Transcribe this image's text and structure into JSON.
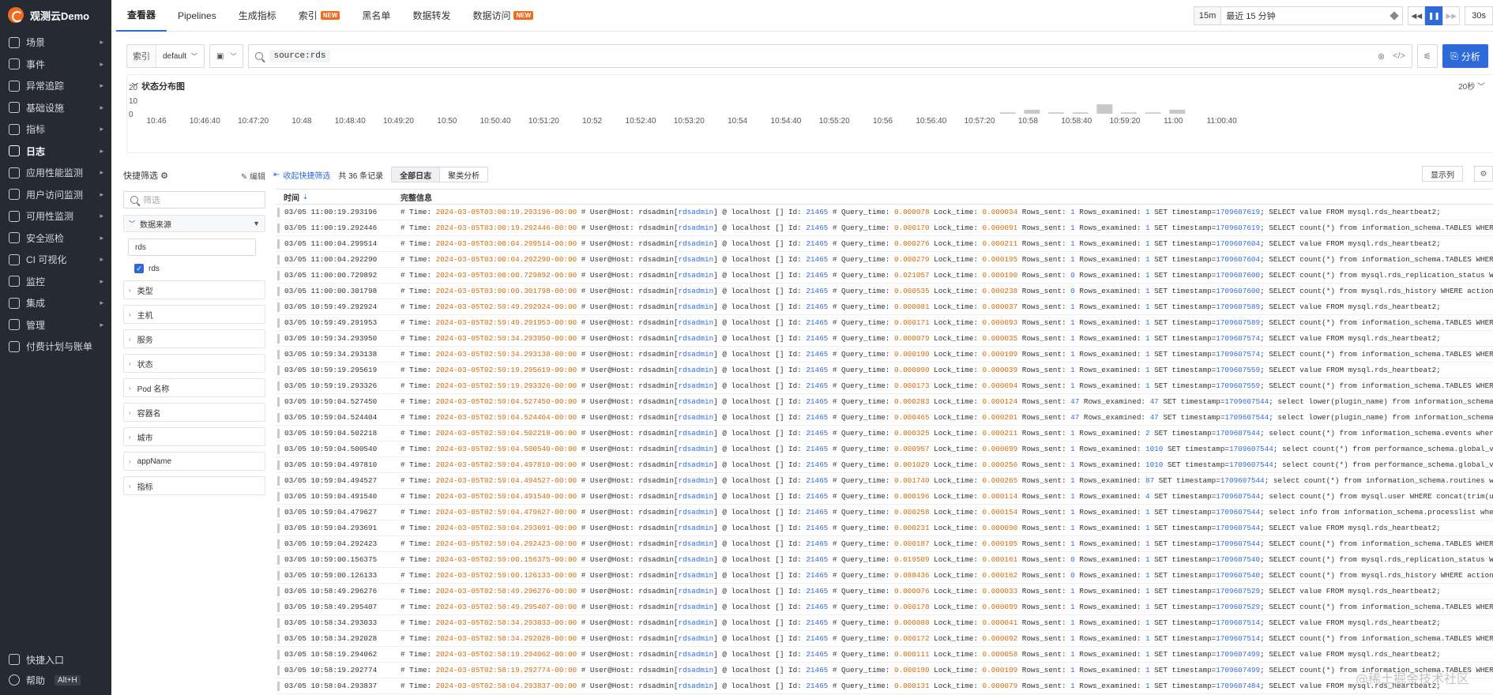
{
  "brand": {
    "name": "观测云Demo"
  },
  "sidebar": {
    "items": [
      {
        "label": "场景",
        "icon": "scene-icon"
      },
      {
        "label": "事件",
        "icon": "event-icon"
      },
      {
        "label": "异常追踪",
        "icon": "bug-icon"
      },
      {
        "label": "基础设施",
        "icon": "infrastructure-icon"
      },
      {
        "label": "指标",
        "icon": "metrics-icon"
      },
      {
        "label": "日志",
        "icon": "log-icon",
        "active": true
      },
      {
        "label": "应用性能监测",
        "icon": "apm-icon"
      },
      {
        "label": "用户访问监测",
        "icon": "rum-icon"
      },
      {
        "label": "可用性监测",
        "icon": "availability-icon"
      },
      {
        "label": "安全巡检",
        "icon": "shield-icon"
      },
      {
        "label": "CI 可视化",
        "icon": "ci-icon"
      },
      {
        "label": "监控",
        "icon": "monitor-icon"
      },
      {
        "label": "集成",
        "icon": "integration-icon"
      },
      {
        "label": "管理",
        "icon": "gear-icon"
      },
      {
        "label": "付费计划与账单",
        "icon": "billing-icon"
      }
    ],
    "bottom": {
      "quick_entry": "快捷入口",
      "help": "帮助",
      "help_key": "Alt+H"
    }
  },
  "topbar": {
    "tabs": [
      {
        "label": "查看器",
        "active": true,
        "new": false
      },
      {
        "label": "Pipelines",
        "new": false
      },
      {
        "label": "生成指标",
        "new": false
      },
      {
        "label": "索引",
        "new": true
      },
      {
        "label": "黑名单",
        "new": false
      },
      {
        "label": "数据转发",
        "new": false
      },
      {
        "label": "数据访问",
        "new": true
      }
    ],
    "new_badge": "NEW",
    "time_short": "15m",
    "time_range": "最近 15 分钟",
    "refresh_interval": "30s"
  },
  "query": {
    "index_label": "索引",
    "index_value": "default",
    "query_text": "source:rds",
    "analyze_label": "分析"
  },
  "chart_data": {
    "type": "bar",
    "title": "状态分布图",
    "interval": "20秒",
    "y_ticks": [
      20,
      10,
      0
    ],
    "ylim": [
      0,
      20
    ],
    "x_tick_labels": [
      "10:46",
      "10:46:40",
      "10:47:20",
      "10:48",
      "10:48:40",
      "10:49:20",
      "10:50",
      "10:50:40",
      "10:51:20",
      "10:52",
      "10:52:40",
      "10:53:20",
      "10:54",
      "10:54:40",
      "10:55:20",
      "10:56",
      "10:56:40",
      "10:57:20",
      "10:58",
      "10:58:40",
      "10:59:20",
      "11:00",
      "11:00:40"
    ],
    "categories": [
      "10:57:40",
      "10:58:00",
      "10:58:20",
      "10:58:40",
      "10:59:00",
      "10:59:20",
      "10:59:40",
      "11:00:00"
    ],
    "values": [
      1,
      3,
      1,
      1,
      7,
      1,
      1,
      3
    ]
  },
  "filters": {
    "title": "快捷筛选",
    "edit": "编辑",
    "search_placeholder": "筛选",
    "open_facet": {
      "label": "数据来源",
      "input_value": "rds",
      "checked_value": "rds"
    },
    "facets": [
      "类型",
      "主机",
      "服务",
      "状态",
      "Pod 名称",
      "容器名",
      "城市",
      "appName",
      "指标"
    ]
  },
  "table_toolbar": {
    "collapse_label": "收起快捷筛选",
    "count_label": "共 36 条记录",
    "view_all": "全部日志",
    "view_cluster": "聚类分析",
    "columns_label": "显示列"
  },
  "table": {
    "col_time": "时间",
    "col_msg": "完整信息",
    "rows": [
      {
        "t": "03/05 11:00:19.293196",
        "iso": "2024-03-05T03:00:19.293196-00:00",
        "qt": "0.000078",
        "lt": "0.000034",
        "rs": "1",
        "re": "1",
        "ts": "1709607619",
        "sql": "SELECT value FROM mysql.rds_heartbeat2;"
      },
      {
        "t": "03/05 11:00:19.292446",
        "iso": "2024-03-05T03:00:19.292446-00:00",
        "qt": "0.000170",
        "lt": "0.000091",
        "rs": "1",
        "re": "1",
        "ts": "1709607619",
        "sql": "SELECT count(*) from information_schema.TABLES WHERE TABLE_..."
      },
      {
        "t": "03/05 11:00:04.299514",
        "iso": "2024-03-05T03:00:04.299514-00:00",
        "qt": "0.000276",
        "lt": "0.000211",
        "rs": "1",
        "re": "1",
        "ts": "1709607604",
        "sql": "SELECT value FROM mysql.rds_heartbeat2;"
      },
      {
        "t": "03/05 11:00:04.292290",
        "iso": "2024-03-05T03:00:04.292290-00:00",
        "qt": "0.000279",
        "lt": "0.000195",
        "rs": "1",
        "re": "1",
        "ts": "1709607604",
        "sql": "SELECT count(*) from information_schema.TABLES WHERE TABLE_..."
      },
      {
        "t": "03/05 11:00:00.729892",
        "iso": "2024-03-05T03:00:00.729892-00:00",
        "qt": "0.021057",
        "lt": "0.000190",
        "rs": "0",
        "re": "1",
        "ts": "1709607600",
        "sql": "SELECT count(*) from mysql.rds_replication_status WHERE mas..."
      },
      {
        "t": "03/05 11:00:00.301798",
        "iso": "2024-03-05T03:00:00.301798-00:00",
        "qt": "0.000535",
        "lt": "0.000238",
        "rs": "0",
        "re": "1",
        "ts": "1709607600",
        "sql": "SELECT count(*) from mysql.rds_history WHERE action = 'disa..."
      },
      {
        "t": "03/05 10:59:49.292924",
        "iso": "2024-03-05T02:59:49.292924-00:00",
        "qt": "0.000081",
        "lt": "0.000037",
        "rs": "1",
        "re": "1",
        "ts": "1709607589",
        "sql": "SELECT value FROM mysql.rds_heartbeat2;"
      },
      {
        "t": "03/05 10:59:49.291953",
        "iso": "2024-03-05T02:59:49.291953-00:00",
        "qt": "0.000171",
        "lt": "0.000093",
        "rs": "1",
        "re": "1",
        "ts": "1709607589",
        "sql": "SELECT count(*) from information_schema.TABLES WHERE TABLE_..."
      },
      {
        "t": "03/05 10:59:34.293950",
        "iso": "2024-03-05T02:59:34.293950-00:00",
        "qt": "0.000079",
        "lt": "0.000035",
        "rs": "1",
        "re": "1",
        "ts": "1709607574",
        "sql": "SELECT value FROM mysql.rds_heartbeat2;"
      },
      {
        "t": "03/05 10:59:34.293138",
        "iso": "2024-03-05T02:59:34.293138-00:00",
        "qt": "0.000190",
        "lt": "0.000109",
        "rs": "1",
        "re": "1",
        "ts": "1709607574",
        "sql": "SELECT count(*) from information_schema.TABLES WHERE TABLE_..."
      },
      {
        "t": "03/05 10:59:19.295619",
        "iso": "2024-03-05T02:59:19.295619-00:00",
        "qt": "0.000090",
        "lt": "0.000039",
        "rs": "1",
        "re": "1",
        "ts": "1709607559",
        "sql": "SELECT value FROM mysql.rds_heartbeat2;"
      },
      {
        "t": "03/05 10:59:19.293326",
        "iso": "2024-03-05T02:59:19.293326-00:00",
        "qt": "0.000173",
        "lt": "0.000094",
        "rs": "1",
        "re": "1",
        "ts": "1709607559",
        "sql": "SELECT count(*) from information_schema.TABLES WHERE TABLE_..."
      },
      {
        "t": "03/05 10:59:04.527450",
        "iso": "2024-03-05T02:59:04.527450-00:00",
        "qt": "0.000283",
        "lt": "0.000124",
        "rs": "47",
        "re": "47",
        "ts": "1709607544",
        "sql": "select lower(plugin_name) from information_schema.plugins;"
      },
      {
        "t": "03/05 10:59:04.524404",
        "iso": "2024-03-05T02:59:04.524404-00:00",
        "qt": "0.000465",
        "lt": "0.000201",
        "rs": "47",
        "re": "47",
        "ts": "1709607544",
        "sql": "select lower(plugin_name) from information_schema.plugins;"
      },
      {
        "t": "03/05 10:59:04.502218",
        "iso": "2024-03-05T02:59:04.502218-00:00",
        "qt": "0.000325",
        "lt": "0.000211",
        "rs": "1",
        "re": "2",
        "ts": "1709607544",
        "sql": "select count(*) from information_schema.events where define..."
      },
      {
        "t": "03/05 10:59:04.500540",
        "iso": "2024-03-05T02:59:04.500540-00:00",
        "qt": "0.000957",
        "lt": "0.000099",
        "rs": "1",
        "re": "1010",
        "ts": "1709607544",
        "sql": "select count(*) from performance_schema.global_variables..."
      },
      {
        "t": "03/05 10:59:04.497810",
        "iso": "2024-03-05T02:59:04.497810-00:00",
        "qt": "0.001029",
        "lt": "0.000256",
        "rs": "1",
        "re": "1010",
        "ts": "1709607544",
        "sql": "select count(*) from performance_schema.global_variables..."
      },
      {
        "t": "03/05 10:59:04.494527",
        "iso": "2024-03-05T02:59:04.494527-00:00",
        "qt": "0.001740",
        "lt": "0.000265",
        "rs": "1",
        "re": "87",
        "ts": "1709607544",
        "sql": "select count(*) from information_schema.routines where ROU..."
      },
      {
        "t": "03/05 10:59:04.491540",
        "iso": "2024-03-05T02:59:04.491540-00:00",
        "qt": "0.000196",
        "lt": "0.000114",
        "rs": "1",
        "re": "4",
        "ts": "1709607544",
        "sql": "select count(*) from mysql.user WHERE concat(trim(user), '@..."
      },
      {
        "t": "03/05 10:59:04.479627",
        "iso": "2024-03-05T02:59:04.479627-00:00",
        "qt": "0.000258",
        "lt": "0.000154",
        "rs": "1",
        "re": "1",
        "ts": "1709607544",
        "sql": "select info from information_schema.processlist where user..."
      },
      {
        "t": "03/05 10:59:04.293691",
        "iso": "2024-03-05T02:59:04.293691-00:00",
        "qt": "0.000231",
        "lt": "0.000090",
        "rs": "1",
        "re": "1",
        "ts": "1709607544",
        "sql": "SELECT value FROM mysql.rds_heartbeat2;"
      },
      {
        "t": "03/05 10:59:04.292423",
        "iso": "2024-03-05T02:59:04.292423-00:00",
        "qt": "0.000187",
        "lt": "0.000105",
        "rs": "1",
        "re": "1",
        "ts": "1709607544",
        "sql": "SELECT count(*) from information_schema.TABLES WHERE TABLE_..."
      },
      {
        "t": "03/05 10:59:00.156375",
        "iso": "2024-03-05T02:59:00.156375-00:00",
        "qt": "0.019509",
        "lt": "0.000161",
        "rs": "0",
        "re": "1",
        "ts": "1709607540",
        "sql": "SELECT count(*) from mysql.rds_replication_status WHERE mas..."
      },
      {
        "t": "03/05 10:59:00.126133",
        "iso": "2024-03-05T02:59:00.126133-00:00",
        "qt": "0.088436",
        "lt": "0.000162",
        "rs": "0",
        "re": "1",
        "ts": "1709607540",
        "sql": "SELECT count(*) from mysql.rds_history WHERE action = 'disa..."
      },
      {
        "t": "03/05 10:58:49.296276",
        "iso": "2024-03-05T02:58:49.296276-00:00",
        "qt": "0.000076",
        "lt": "0.000033",
        "rs": "1",
        "re": "1",
        "ts": "1709607529",
        "sql": "SELECT value FROM mysql.rds_heartbeat2;"
      },
      {
        "t": "03/05 10:58:49.295407",
        "iso": "2024-03-05T02:58:49.295407-00:00",
        "qt": "0.000178",
        "lt": "0.000099",
        "rs": "1",
        "re": "1",
        "ts": "1709607529",
        "sql": "SELECT count(*) from information_schema.TABLES WHERE TABLE_..."
      },
      {
        "t": "03/05 10:58:34.293033",
        "iso": "2024-03-05T02:58:34.293033-00:00",
        "qt": "0.000088",
        "lt": "0.000041",
        "rs": "1",
        "re": "1",
        "ts": "1709607514",
        "sql": "SELECT value FROM mysql.rds_heartbeat2;"
      },
      {
        "t": "03/05 10:58:34.292028",
        "iso": "2024-03-05T02:58:34.292028-00:00",
        "qt": "0.000172",
        "lt": "0.000092",
        "rs": "1",
        "re": "1",
        "ts": "1709607514",
        "sql": "SELECT count(*) from information_schema.TABLES WHERE TABLE_..."
      },
      {
        "t": "03/05 10:58:19.294062",
        "iso": "2024-03-05T02:58:19.294062-00:00",
        "qt": "0.000111",
        "lt": "0.000058",
        "rs": "1",
        "re": "1",
        "ts": "1709607499",
        "sql": "SELECT value FROM mysql.rds_heartbeat2;"
      },
      {
        "t": "03/05 10:58:19.292774",
        "iso": "2024-03-05T02:58:19.292774-00:00",
        "qt": "0.000190",
        "lt": "0.000109",
        "rs": "1",
        "re": "1",
        "ts": "1709607499",
        "sql": "SELECT count(*) from information_schema.TABLES WHERE TABLE_..."
      },
      {
        "t": "03/05 10:58:04.293837",
        "iso": "2024-03-05T02:58:04.293837-00:00",
        "qt": "0.000131",
        "lt": "0.000079",
        "rs": "1",
        "re": "1",
        "ts": "1709607484",
        "sql": "SELECT value FROM mysql.rds_heartbeat2;"
      }
    ],
    "host_user": "rdsadmin",
    "host": "localhost",
    "conn_id": "21465"
  },
  "watermark": "@稀土掘金技术社区"
}
